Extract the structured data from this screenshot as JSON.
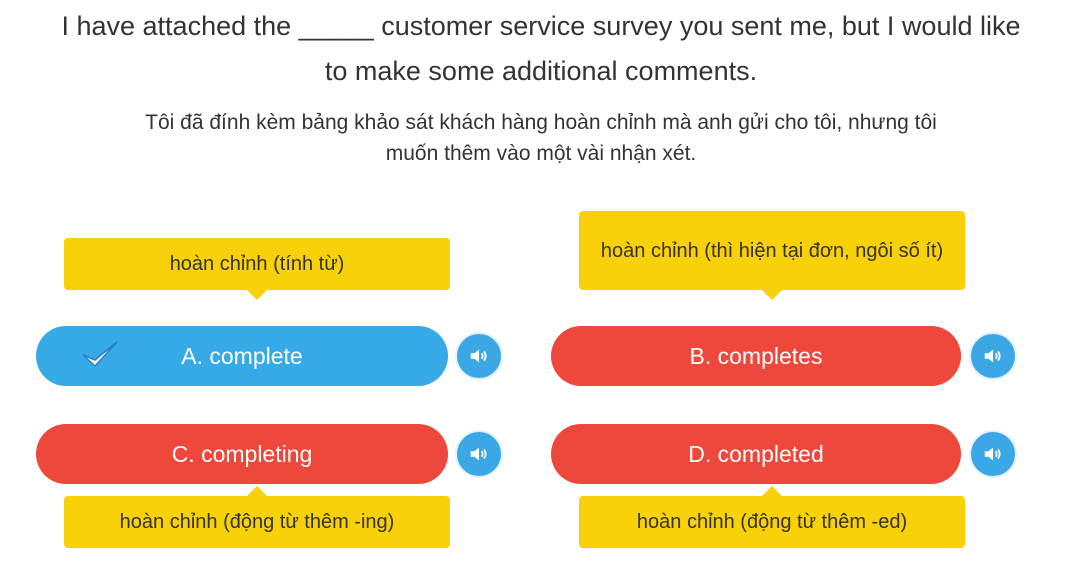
{
  "question": {
    "line1": "I have attached the _____ customer service survey you sent me, but I would like",
    "line2": "to make some additional comments."
  },
  "translation": {
    "line1": "Tôi đã đính kèm bảng khảo sát khách hàng hoàn chỉnh mà anh gửi cho tôi, nhưng tôi",
    "line2": "muốn thêm vào một vài nhận xét."
  },
  "options": [
    {
      "label": "A. complete",
      "hint": "hoàn chỉnh (tính từ)",
      "state": "correct"
    },
    {
      "label": "B. completes",
      "hint": "hoàn chỉnh (thì hiện tại đơn, ngôi số ít)",
      "state": "wrong"
    },
    {
      "label": "C. completing",
      "hint": "hoàn chỉnh (động từ thêm -ing)",
      "state": "wrong"
    },
    {
      "label": "D. completed",
      "hint": "hoàn chỉnh (động từ thêm -ed)",
      "state": "wrong"
    }
  ],
  "icons": {
    "check": "check-icon",
    "audio": "speaker-icon"
  },
  "colors": {
    "correct": "#36aae6",
    "wrong": "#ee473b",
    "hint": "#f9d108",
    "speaker": "#3ba8e5"
  }
}
